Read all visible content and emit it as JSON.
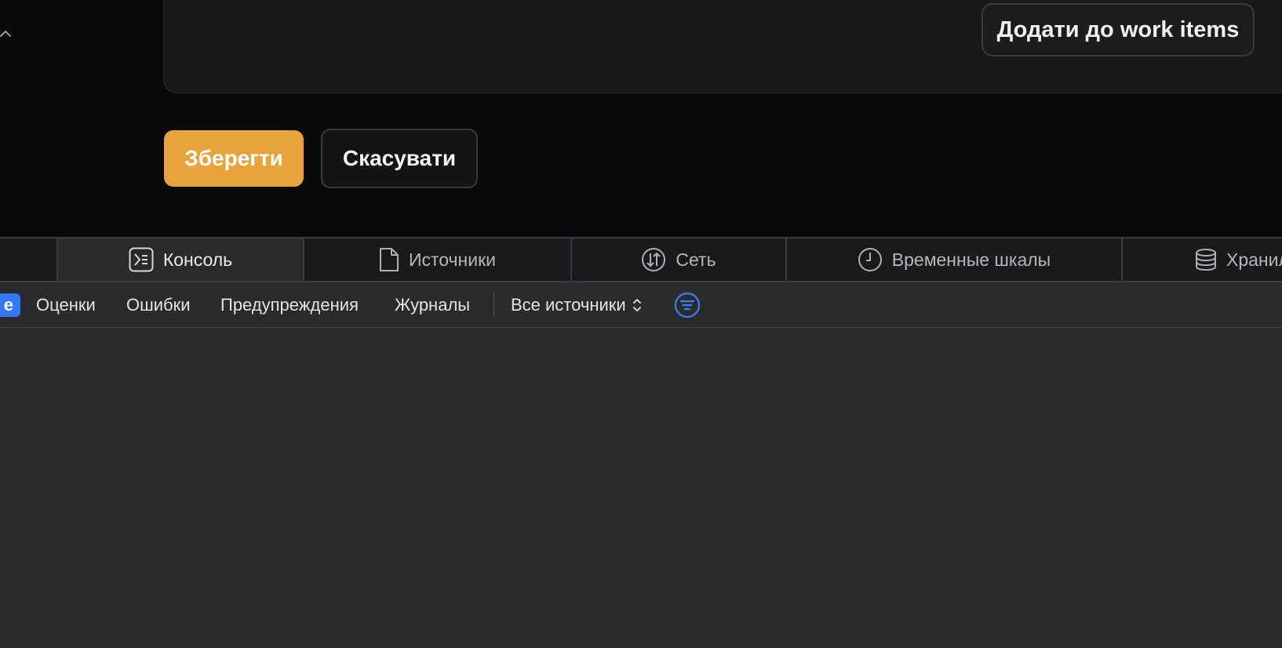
{
  "form": {
    "add_work_items_label": "Додати до work items",
    "save_label": "Зберегти",
    "cancel_label": "Скасувати",
    "save_color": "#e8a33c"
  },
  "devtools": {
    "tabs": [
      {
        "label": "Консоль",
        "icon": "console-icon",
        "active": true
      },
      {
        "label": "Источники",
        "icon": "document-icon",
        "active": false
      },
      {
        "label": "Сеть",
        "icon": "network-icon",
        "active": false
      },
      {
        "label": "Временные шкалы",
        "icon": "clock-icon",
        "active": false
      },
      {
        "label": "Хранил",
        "icon": "storage-icon",
        "active": false
      }
    ],
    "filters": {
      "active_pill": "е",
      "items": [
        "Оценки",
        "Ошибки",
        "Предупреждения",
        "Журналы"
      ],
      "sources_label": "Все источники",
      "accent_color": "#3478f6"
    }
  }
}
